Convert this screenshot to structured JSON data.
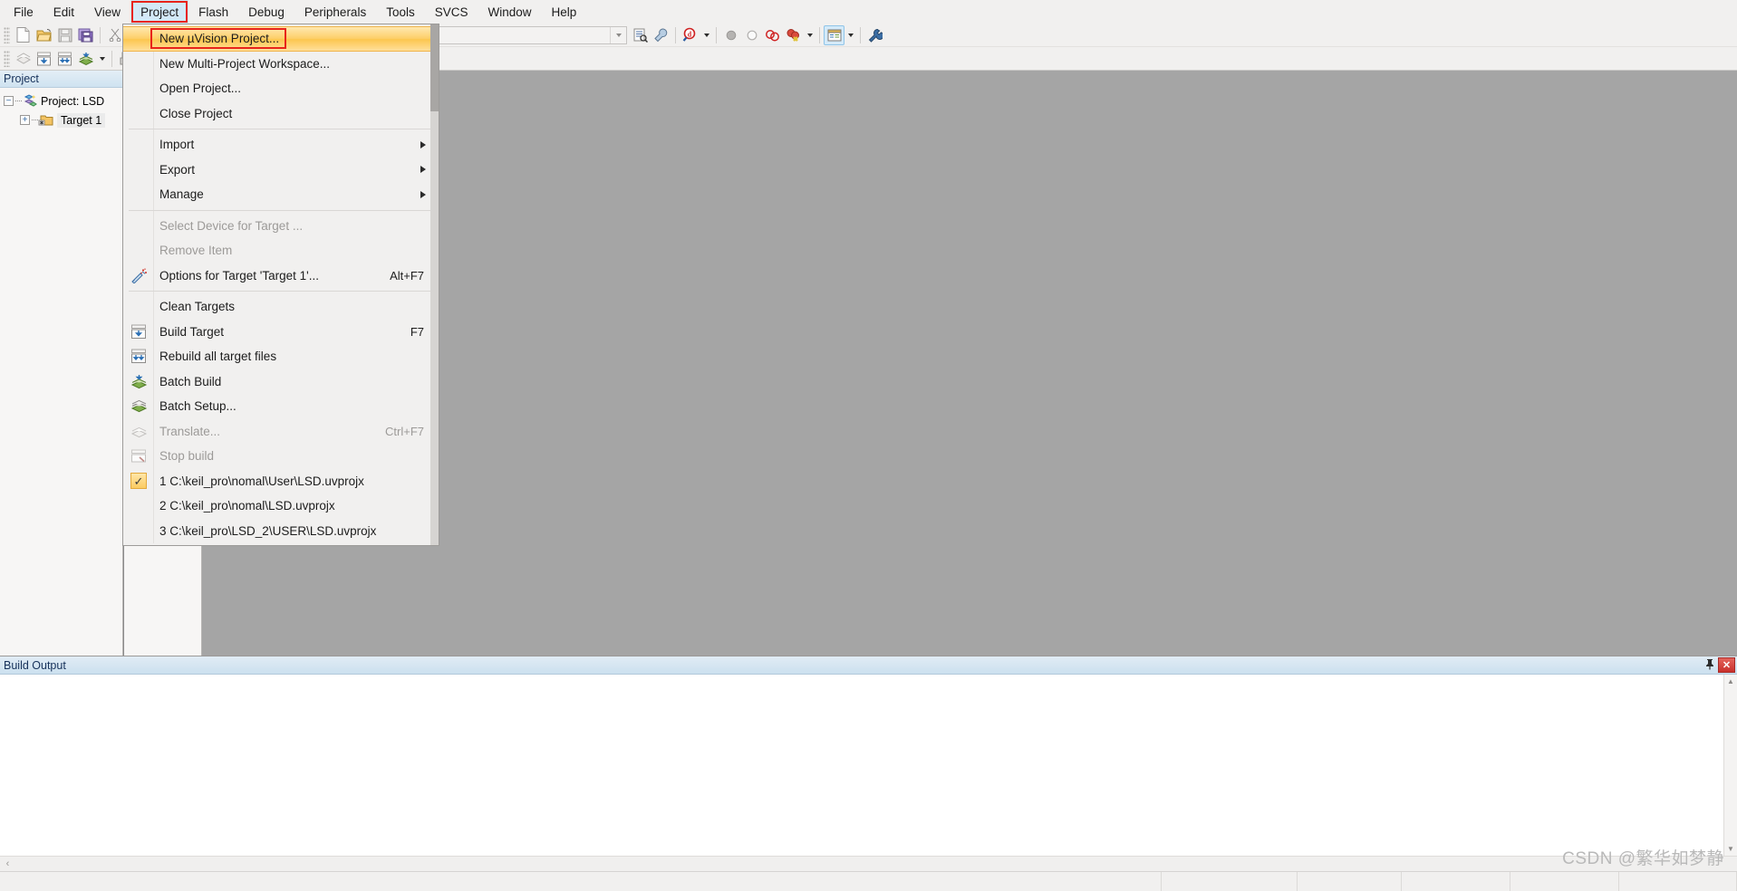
{
  "menubar": {
    "items": [
      {
        "label": "File",
        "name": "menu-file"
      },
      {
        "label": "Edit",
        "name": "menu-edit"
      },
      {
        "label": "View",
        "name": "menu-view"
      },
      {
        "label": "Project",
        "name": "menu-project",
        "open": true
      },
      {
        "label": "Flash",
        "name": "menu-flash"
      },
      {
        "label": "Debug",
        "name": "menu-debug"
      },
      {
        "label": "Peripherals",
        "name": "menu-peripherals"
      },
      {
        "label": "Tools",
        "name": "menu-tools"
      },
      {
        "label": "SVCS",
        "name": "menu-svcs"
      },
      {
        "label": "Window",
        "name": "menu-window"
      },
      {
        "label": "Help",
        "name": "menu-help"
      }
    ]
  },
  "project_menu": {
    "rows": [
      {
        "label": "New µVision Project...",
        "icon": "",
        "accel": "",
        "selected": true,
        "disabled": false
      },
      {
        "label": "New Multi-Project Workspace...",
        "icon": "",
        "accel": "",
        "disabled": false
      },
      {
        "label": "Open Project...",
        "icon": "",
        "accel": "",
        "disabled": false
      },
      {
        "label": "Close Project",
        "icon": "",
        "accel": "",
        "disabled": false
      },
      {
        "separator": true
      },
      {
        "label": "Import",
        "icon": "",
        "accel": "",
        "submenu": true,
        "disabled": false
      },
      {
        "label": "Export",
        "icon": "",
        "accel": "",
        "submenu": true,
        "disabled": false
      },
      {
        "label": "Manage",
        "icon": "",
        "accel": "",
        "submenu": true,
        "disabled": false
      },
      {
        "separator": true
      },
      {
        "label": "Select Device for Target ...",
        "icon": "",
        "accel": "",
        "disabled": true
      },
      {
        "label": "Remove Item",
        "icon": "",
        "accel": "",
        "disabled": true
      },
      {
        "label": "Options for Target 'Target 1'...",
        "icon": "wand-icon",
        "accel": "Alt+F7",
        "disabled": false
      },
      {
        "separator": true
      },
      {
        "label": "Clean Targets",
        "icon": "",
        "accel": "",
        "disabled": false
      },
      {
        "label": "Build Target",
        "icon": "build-target-icon",
        "accel": "F7",
        "disabled": false
      },
      {
        "label": "Rebuild all target files",
        "icon": "rebuild-icon",
        "accel": "",
        "disabled": false
      },
      {
        "label": "Batch Build",
        "icon": "batch-build-icon",
        "accel": "",
        "disabled": false
      },
      {
        "label": "Batch Setup...",
        "icon": "batch-setup-icon",
        "accel": "",
        "disabled": false
      },
      {
        "label": "Translate...",
        "icon": "translate-icon",
        "accel": "Ctrl+F7",
        "disabled": true
      },
      {
        "label": "Stop build",
        "icon": "stop-build-icon",
        "accel": "",
        "disabled": true
      },
      {
        "label": "1 C:\\keil_pro\\nomal\\User\\LSD.uvprojx",
        "icon": "checkmark-icon",
        "accel": "",
        "disabled": false
      },
      {
        "label": "2 C:\\keil_pro\\nomal\\LSD.uvprojx",
        "icon": "",
        "accel": "",
        "disabled": false
      },
      {
        "label": "3 C:\\keil_pro\\LSD_2\\USER\\LSD.uvprojx",
        "icon": "",
        "accel": "",
        "disabled": false
      }
    ]
  },
  "toolbar1": {
    "buttons": [
      {
        "name": "new-file-button",
        "icon": "new-file-icon"
      },
      {
        "name": "open-file-button",
        "icon": "open-folder-icon"
      },
      {
        "name": "save-button",
        "icon": "save-icon"
      },
      {
        "name": "save-all-button",
        "icon": "save-all-icon"
      },
      {
        "name": "cut-button",
        "icon": "cut-icon"
      },
      {
        "name": "copy-button",
        "icon": "copy-icon"
      },
      {
        "name": "paste-button",
        "icon": "paste-icon"
      },
      {
        "name": "undo-button",
        "icon": "undo-icon"
      },
      {
        "name": "redo-button",
        "icon": "redo-icon"
      },
      {
        "name": "navigate-back-button",
        "icon": "arrow-left-icon"
      },
      {
        "name": "navigate-forward-button",
        "icon": "arrow-right-icon"
      },
      {
        "name": "indent-button",
        "icon": "indent-icon"
      },
      {
        "name": "outdent-button",
        "icon": "outdent-icon"
      },
      {
        "name": "comment-button",
        "icon": "comment-icon"
      },
      {
        "name": "uncomment-button",
        "icon": "uncomment-icon"
      },
      {
        "name": "bookmark-button",
        "icon": "bookmark-folder-icon"
      }
    ],
    "search": {
      "value": "",
      "placeholder": ""
    },
    "right_buttons": [
      {
        "name": "find-in-files-button",
        "icon": "find-in-files-icon"
      },
      {
        "name": "configure-button",
        "icon": "wrench-blue-icon"
      },
      {
        "name": "debug-session-button",
        "icon": "magnifier-d-icon"
      },
      {
        "name": "breakpoint-insert-button",
        "icon": "filled-circle-icon"
      },
      {
        "name": "breakpoint-disable-button",
        "icon": "hollow-circle-icon"
      },
      {
        "name": "breakpoint-disable-all-button",
        "icon": "double-circle-icon"
      },
      {
        "name": "breakpoint-kill-all-button",
        "icon": "circles-x-icon"
      },
      {
        "name": "project-window-button",
        "icon": "project-window-icon",
        "active": true
      },
      {
        "name": "configuration-wizard-button",
        "icon": "wrench-icon"
      }
    ]
  },
  "toolbar2": {
    "buttons": [
      {
        "name": "translate-button",
        "icon": "translate-icon"
      },
      {
        "name": "build-button",
        "icon": "build-target-icon"
      },
      {
        "name": "rebuild-button",
        "icon": "rebuild-icon"
      },
      {
        "name": "batch-build-button",
        "icon": "batch-build-icon"
      },
      {
        "name": "download-button",
        "icon": "download-icon"
      },
      {
        "name": "target-options-button",
        "icon": "target-options-icon"
      },
      {
        "name": "manage-runtime-button",
        "icon": "manage-runtime-icon"
      },
      {
        "name": "manage-project-items-button",
        "icon": "manage-items-icon"
      }
    ]
  },
  "sidebar": {
    "title": "Project",
    "tree": [
      {
        "label": "Project: LSD",
        "name": "tree-item-project",
        "expander": "−",
        "icon": "project-icon",
        "indent": false
      },
      {
        "label": "Target 1",
        "name": "tree-item-target1",
        "expander": "+",
        "icon": "target-folder-icon",
        "indent": true,
        "selected": true
      }
    ]
  },
  "build_output": {
    "title": "Build Output",
    "content": "",
    "pin_icon": "pin-icon",
    "close_label": "✕"
  },
  "statusbar": {
    "cells": [
      "",
      "",
      "",
      "",
      "",
      ""
    ]
  },
  "watermark": {
    "text": "CSDN @繁华如梦静"
  },
  "colors": {
    "accent_red": "#e8241a",
    "menu_highlight": "#fdcf69",
    "panel_title": "#cfe2f0",
    "editor_bg": "#a5a5a5"
  }
}
